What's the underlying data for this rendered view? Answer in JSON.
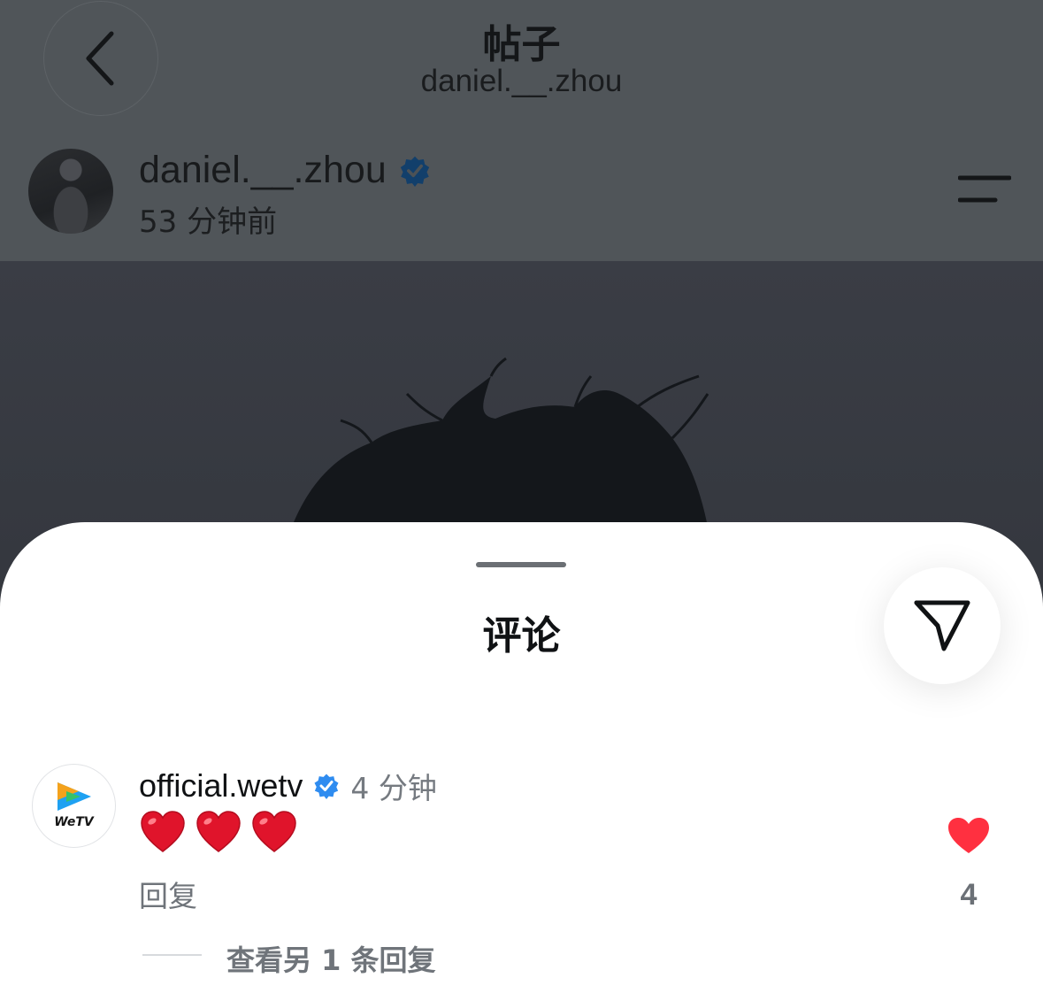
{
  "header": {
    "title": "帖子",
    "subtitle": "daniel.__.zhou",
    "back_icon": "chevron-left-icon"
  },
  "post": {
    "username": "daniel.__.zhou",
    "verified": true,
    "time_ago": "53 分钟前",
    "menu_icon": "menu-lines-icon"
  },
  "comments_sheet": {
    "title": "评论",
    "share_icon": "send-icon",
    "comments": [
      {
        "username": "official.wetv",
        "avatar_text": "WeTV",
        "verified": true,
        "time": "4 分钟",
        "content_emojis": [
          "heart",
          "heart",
          "heart"
        ],
        "reply_label": "回复",
        "like_count": "4",
        "liked": true,
        "view_replies_label": "查看另 1 条回复"
      }
    ]
  },
  "colors": {
    "verified_blue": "#2f8cf0",
    "like_red": "#ff3040",
    "dim_overlay": "#505559"
  }
}
